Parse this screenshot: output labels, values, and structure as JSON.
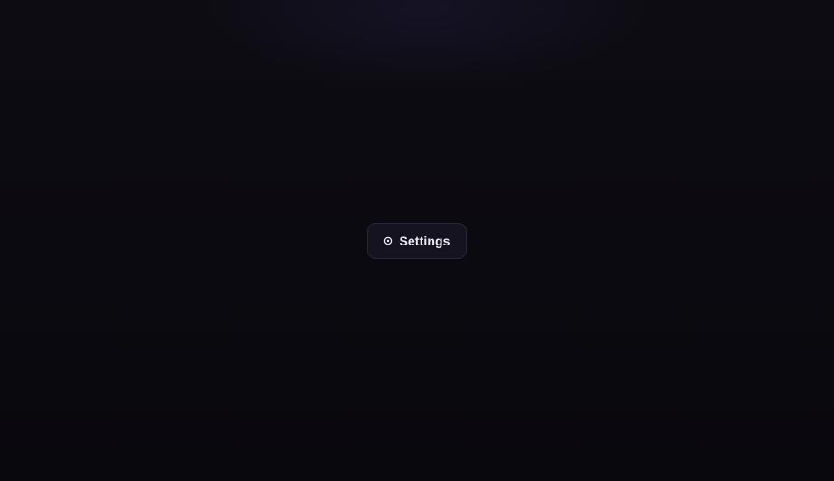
{
  "settings_button": {
    "label": "Settings",
    "icon": "gear-icon"
  },
  "colors": {
    "background": "#0c0b11",
    "button_background": "#15131f",
    "button_border": "#2a2838",
    "text": "#ecebf3"
  }
}
